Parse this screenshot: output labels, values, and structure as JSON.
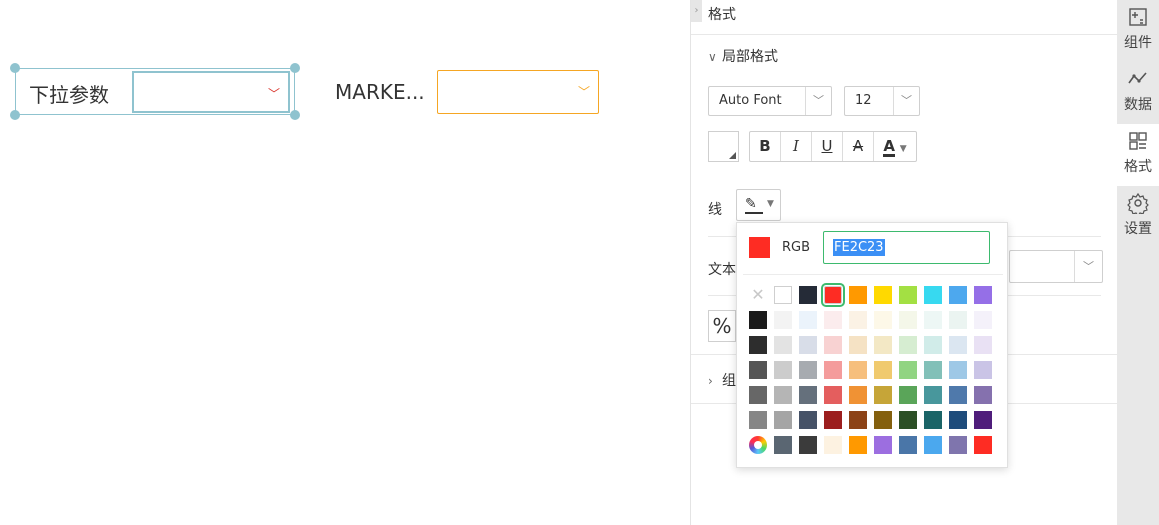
{
  "canvas": {
    "widget1": {
      "label": "下拉参数",
      "chevron": "chevron-down-icon"
    },
    "widget2": {
      "label": "MARKE...",
      "chevron": "chevron-down-icon"
    }
  },
  "panel": {
    "title": "格式",
    "local_format_title": "局部格式",
    "font_family": "Auto Font",
    "font_size": "12",
    "format_buttons": {
      "bold": "B",
      "italic": "I",
      "underline": "U",
      "strike": "A",
      "color": "A"
    },
    "line_label": "线",
    "text_label": "文本",
    "percent_label": "%",
    "group_title": "组"
  },
  "picker": {
    "current_color": "#FE2C23",
    "rgb_label": "RGB",
    "hex_value": "FE2C23",
    "palette": [
      [
        "none",
        "#ffffff",
        "#252b37",
        "#fe2c23",
        "#ff9900",
        "#ffd900",
        "#a3e043",
        "#37d9f0",
        "#4da8ee",
        "#956fe7"
      ],
      [
        "#1b1b1b",
        "#f3f3f3",
        "#ebf3fb",
        "#fbeced",
        "#fbf2e5",
        "#fdf8e8",
        "#f4f7e9",
        "#edf7f5",
        "#ebf4f1",
        "#f4f1fa"
      ],
      [
        "#2d2d2d",
        "#e3e3e3",
        "#d8dde8",
        "#f8d2d2",
        "#f5e2c4",
        "#f3e8c5",
        "#d6edd1",
        "#d1ece9",
        "#dbe6f1",
        "#e9e1f4"
      ],
      [
        "#555555",
        "#cccccc",
        "#a7abb0",
        "#f49c9c",
        "#f6bf7d",
        "#f0ca6e",
        "#91d482",
        "#82c0b8",
        "#9ec8e6",
        "#cac4e6"
      ],
      [
        "#676767",
        "#b5b5b5",
        "#65707c",
        "#e45e5e",
        "#f09234",
        "#c6a538",
        "#5aa559",
        "#48979c",
        "#4f79ab",
        "#8571ae"
      ],
      [
        "#868686",
        "#a5a5a5",
        "#465267",
        "#9c1e1e",
        "#8c4216",
        "#84600e",
        "#2c4f25",
        "#1b6467",
        "#1e4c7b",
        "#4f1d7b"
      ],
      [
        "wheel",
        "#5a6672",
        "#3b3b3b",
        "#fdf2e1",
        "#ff9900",
        "#9c6ee0",
        "#4a76a8",
        "#4ba8ee",
        "#7f75ad",
        "#fe2c23"
      ]
    ]
  },
  "sidebar": {
    "items": [
      {
        "label": "组件",
        "icon": "component-icon"
      },
      {
        "label": "数据",
        "icon": "data-icon"
      },
      {
        "label": "格式",
        "icon": "format-icon",
        "active": true
      },
      {
        "label": "设置",
        "icon": "settings-icon"
      }
    ]
  }
}
